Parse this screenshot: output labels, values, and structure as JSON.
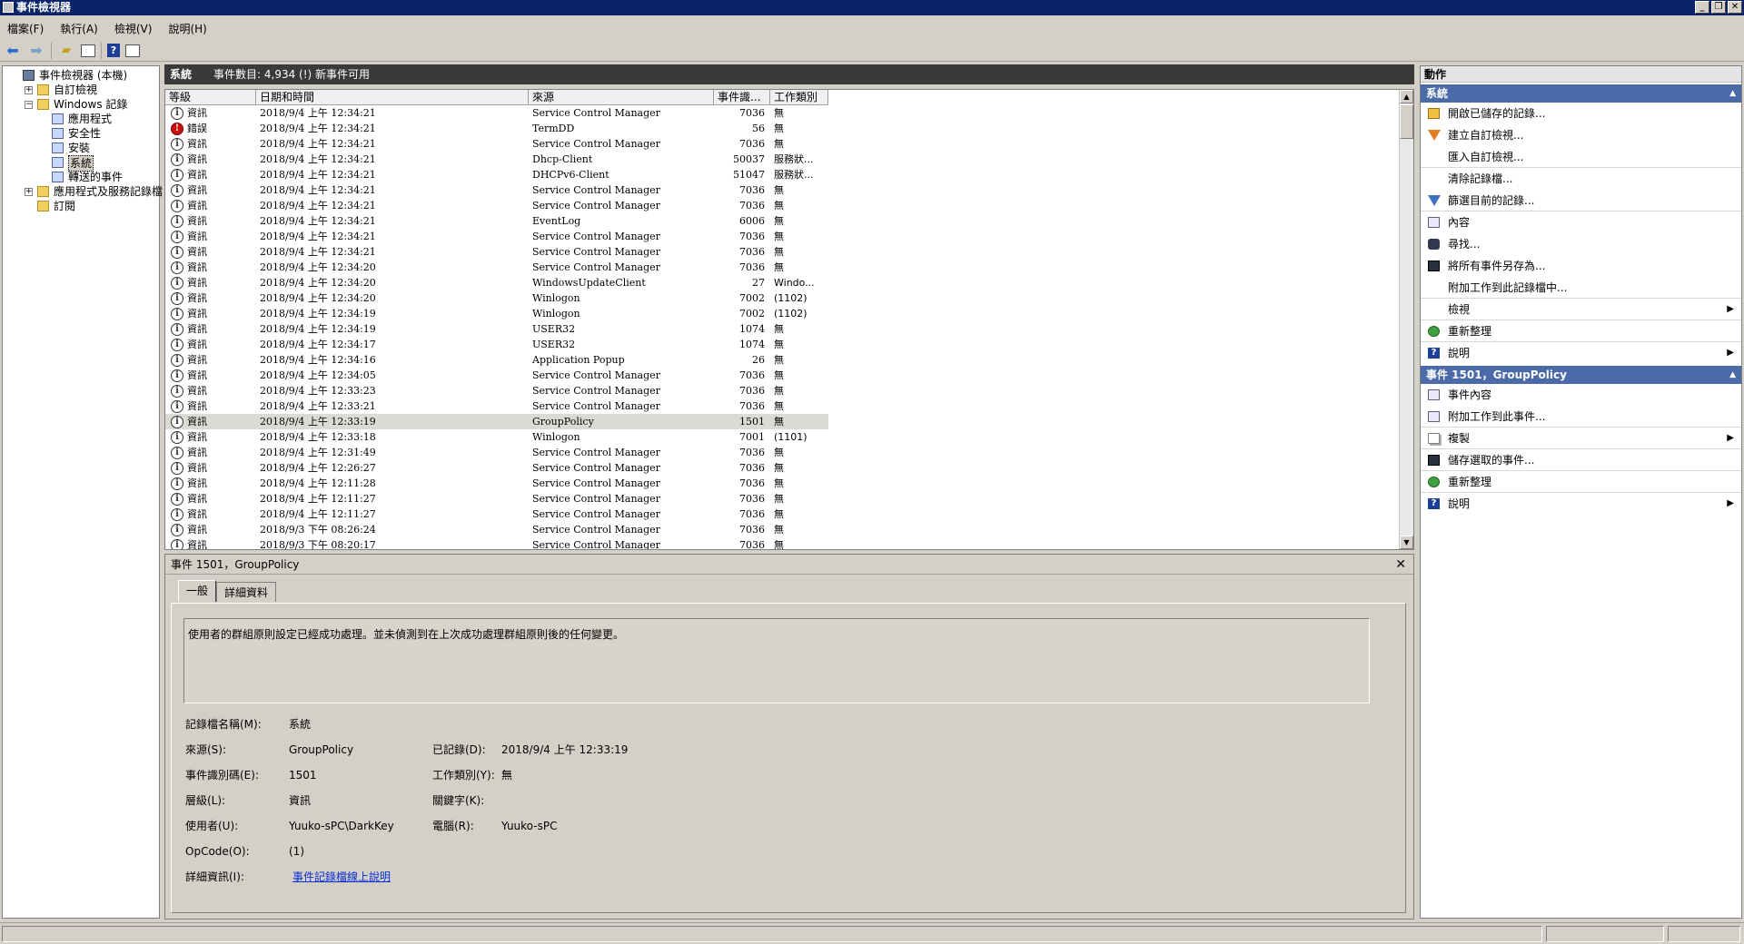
{
  "window": {
    "title": "事件檢視器"
  },
  "menu": [
    "檔案(F)",
    "執行(A)",
    "檢視(V)",
    "說明(H)"
  ],
  "tree": [
    {
      "label": "事件檢視器 (本機)",
      "level": 0,
      "expander": "",
      "icon": "event-viewer-icon"
    },
    {
      "label": "自訂檢視",
      "level": 1,
      "expander": "+",
      "icon": "folder-icon"
    },
    {
      "label": "Windows 記錄",
      "level": 1,
      "expander": "−",
      "icon": "folder-icon"
    },
    {
      "label": "應用程式",
      "level": 2,
      "expander": "",
      "icon": "log-icon"
    },
    {
      "label": "安全性",
      "level": 2,
      "expander": "",
      "icon": "log-icon"
    },
    {
      "label": "安裝",
      "level": 2,
      "expander": "",
      "icon": "log-icon"
    },
    {
      "label": "系統",
      "level": 2,
      "expander": "",
      "icon": "log-icon",
      "selected": true
    },
    {
      "label": "轉送的事件",
      "level": 2,
      "expander": "",
      "icon": "log-icon"
    },
    {
      "label": "應用程式及服務記錄檔",
      "level": 1,
      "expander": "+",
      "icon": "folder-icon"
    },
    {
      "label": "訂閱",
      "level": 1,
      "expander": "",
      "icon": "folder-icon"
    }
  ],
  "center": {
    "log_name": "系統",
    "event_count": "事件數目: 4,934 (!) 新事件可用"
  },
  "grid": {
    "columns": [
      "等級",
      "日期和時間",
      "來源",
      "事件識...",
      "工作類別"
    ],
    "rows": [
      {
        "level": "資訊",
        "type": "info",
        "datetime": "2018/9/4 上午 12:34:21",
        "source": "Service Control Manager",
        "id": "7036",
        "category": "無"
      },
      {
        "level": "錯誤",
        "type": "error",
        "datetime": "2018/9/4 上午 12:34:21",
        "source": "TermDD",
        "id": "56",
        "category": "無"
      },
      {
        "level": "資訊",
        "type": "info",
        "datetime": "2018/9/4 上午 12:34:21",
        "source": "Service Control Manager",
        "id": "7036",
        "category": "無"
      },
      {
        "level": "資訊",
        "type": "info",
        "datetime": "2018/9/4 上午 12:34:21",
        "source": "Dhcp-Client",
        "id": "50037",
        "category": "服務狀..."
      },
      {
        "level": "資訊",
        "type": "info",
        "datetime": "2018/9/4 上午 12:34:21",
        "source": "DHCPv6-Client",
        "id": "51047",
        "category": "服務狀..."
      },
      {
        "level": "資訊",
        "type": "info",
        "datetime": "2018/9/4 上午 12:34:21",
        "source": "Service Control Manager",
        "id": "7036",
        "category": "無"
      },
      {
        "level": "資訊",
        "type": "info",
        "datetime": "2018/9/4 上午 12:34:21",
        "source": "Service Control Manager",
        "id": "7036",
        "category": "無"
      },
      {
        "level": "資訊",
        "type": "info",
        "datetime": "2018/9/4 上午 12:34:21",
        "source": "EventLog",
        "id": "6006",
        "category": "無"
      },
      {
        "level": "資訊",
        "type": "info",
        "datetime": "2018/9/4 上午 12:34:21",
        "source": "Service Control Manager",
        "id": "7036",
        "category": "無"
      },
      {
        "level": "資訊",
        "type": "info",
        "datetime": "2018/9/4 上午 12:34:21",
        "source": "Service Control Manager",
        "id": "7036",
        "category": "無"
      },
      {
        "level": "資訊",
        "type": "info",
        "datetime": "2018/9/4 上午 12:34:20",
        "source": "Service Control Manager",
        "id": "7036",
        "category": "無"
      },
      {
        "level": "資訊",
        "type": "info",
        "datetime": "2018/9/4 上午 12:34:20",
        "source": "WindowsUpdateClient",
        "id": "27",
        "category": "Windo..."
      },
      {
        "level": "資訊",
        "type": "info",
        "datetime": "2018/9/4 上午 12:34:20",
        "source": "Winlogon",
        "id": "7002",
        "category": "(1102)"
      },
      {
        "level": "資訊",
        "type": "info",
        "datetime": "2018/9/4 上午 12:34:19",
        "source": "Winlogon",
        "id": "7002",
        "category": "(1102)"
      },
      {
        "level": "資訊",
        "type": "info",
        "datetime": "2018/9/4 上午 12:34:19",
        "source": "USER32",
        "id": "1074",
        "category": "無"
      },
      {
        "level": "資訊",
        "type": "info",
        "datetime": "2018/9/4 上午 12:34:17",
        "source": "USER32",
        "id": "1074",
        "category": "無"
      },
      {
        "level": "資訊",
        "type": "info",
        "datetime": "2018/9/4 上午 12:34:16",
        "source": "Application Popup",
        "id": "26",
        "category": "無"
      },
      {
        "level": "資訊",
        "type": "info",
        "datetime": "2018/9/4 上午 12:34:05",
        "source": "Service Control Manager",
        "id": "7036",
        "category": "無"
      },
      {
        "level": "資訊",
        "type": "info",
        "datetime": "2018/9/4 上午 12:33:23",
        "source": "Service Control Manager",
        "id": "7036",
        "category": "無"
      },
      {
        "level": "資訊",
        "type": "info",
        "datetime": "2018/9/4 上午 12:33:21",
        "source": "Service Control Manager",
        "id": "7036",
        "category": "無"
      },
      {
        "level": "資訊",
        "type": "info",
        "datetime": "2018/9/4 上午 12:33:19",
        "source": "GroupPolicy",
        "id": "1501",
        "category": "無",
        "selected": true
      },
      {
        "level": "資訊",
        "type": "info",
        "datetime": "2018/9/4 上午 12:33:18",
        "source": "Winlogon",
        "id": "7001",
        "category": "(1101)"
      },
      {
        "level": "資訊",
        "type": "info",
        "datetime": "2018/9/4 上午 12:31:49",
        "source": "Service Control Manager",
        "id": "7036",
        "category": "無"
      },
      {
        "level": "資訊",
        "type": "info",
        "datetime": "2018/9/4 上午 12:26:27",
        "source": "Service Control Manager",
        "id": "7036",
        "category": "無"
      },
      {
        "level": "資訊",
        "type": "info",
        "datetime": "2018/9/4 上午 12:11:28",
        "source": "Service Control Manager",
        "id": "7036",
        "category": "無"
      },
      {
        "level": "資訊",
        "type": "info",
        "datetime": "2018/9/4 上午 12:11:27",
        "source": "Service Control Manager",
        "id": "7036",
        "category": "無"
      },
      {
        "level": "資訊",
        "type": "info",
        "datetime": "2018/9/4 上午 12:11:27",
        "source": "Service Control Manager",
        "id": "7036",
        "category": "無"
      },
      {
        "level": "資訊",
        "type": "info",
        "datetime": "2018/9/3 下午 08:26:24",
        "source": "Service Control Manager",
        "id": "7036",
        "category": "無"
      },
      {
        "level": "資訊",
        "type": "info",
        "datetime": "2018/9/3 下午 08:20:17",
        "source": "Service Control Manager",
        "id": "7036",
        "category": "無"
      }
    ]
  },
  "detail": {
    "title": "事件 1501，GroupPolicy",
    "tabs": [
      "一般",
      "詳細資料"
    ],
    "description": "使用者的群組原則設定已經成功處理。並未偵測到在上次成功處理群組原則後的任何變更。",
    "labels": {
      "log_name": "記錄檔名稱(M):",
      "source": "來源(S):",
      "event_id": "事件識別碼(E):",
      "level": "層級(L):",
      "user": "使用者(U):",
      "opcode": "OpCode(O):",
      "more_info": "詳細資訊(I):",
      "logged": "已記錄(D):",
      "task_category": "工作類別(Y):",
      "keywords": "關鍵字(K):",
      "computer": "電腦(R):"
    },
    "values": {
      "log_name": "系統",
      "source": "GroupPolicy",
      "event_id": "1501",
      "level": "資訊",
      "user": "Yuuko-sPC\\DarkKey",
      "opcode": "(1)",
      "more_info": "事件記錄檔線上說明",
      "logged": "2018/9/4 上午 12:33:19",
      "task_category": "無",
      "keywords": "",
      "computer": "Yuuko-sPC"
    }
  },
  "actions": {
    "header": "動作",
    "section1": {
      "title": "系統",
      "items": [
        {
          "label": "開啟已儲存的記錄...",
          "icon": "open-icon"
        },
        {
          "label": "建立自訂檢視...",
          "icon": "filter-icon"
        },
        {
          "label": "匯入自訂檢視...",
          "icon": "",
          "sep": true
        },
        {
          "label": "清除記錄檔...",
          "icon": ""
        },
        {
          "label": "篩選目前的記錄...",
          "icon": "filter2-icon",
          "sep": true
        },
        {
          "label": "內容",
          "icon": "props-icon"
        },
        {
          "label": "尋找...",
          "icon": "find-icon"
        },
        {
          "label": "將所有事件另存為...",
          "icon": "save-icon"
        },
        {
          "label": "附加工作到此記錄檔中...",
          "icon": "",
          "sep": true
        },
        {
          "label": "檢視",
          "icon": "",
          "arrow": "▶",
          "sep": true
        },
        {
          "label": "重新整理",
          "icon": "refresh-icon",
          "sep": true
        },
        {
          "label": "說明",
          "icon": "help-icon",
          "arrow": "▶"
        }
      ]
    },
    "section2": {
      "title": "事件 1501，GroupPolicy",
      "items": [
        {
          "label": "事件內容",
          "icon": "props-icon"
        },
        {
          "label": "附加工作到此事件...",
          "icon": "props-icon",
          "sep": true
        },
        {
          "label": "複製",
          "icon": "copy-icon",
          "arrow": "▶",
          "sep": true
        },
        {
          "label": "儲存選取的事件...",
          "icon": "save-icon",
          "sep": true
        },
        {
          "label": "重新整理",
          "icon": "refresh-icon",
          "sep": true
        },
        {
          "label": "說明",
          "icon": "help-icon",
          "arrow": "▶"
        }
      ]
    }
  }
}
